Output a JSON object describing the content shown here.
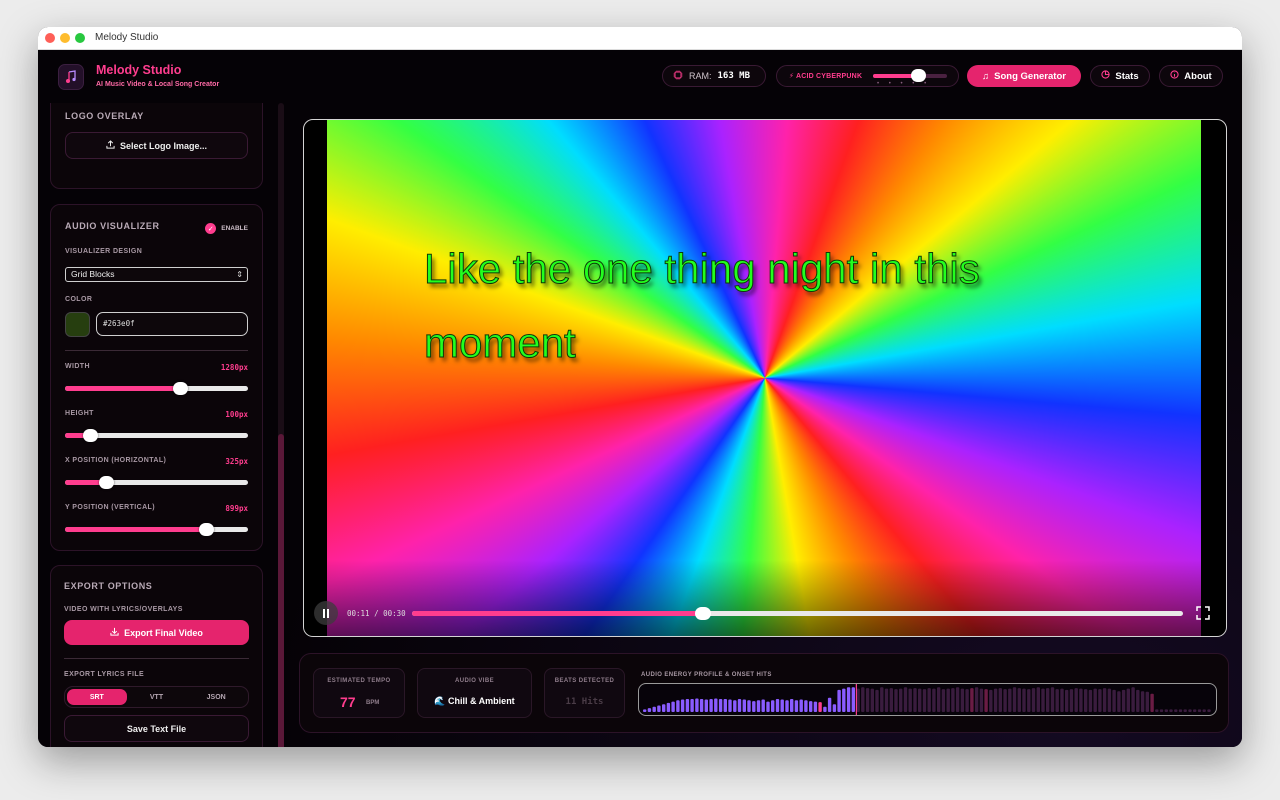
{
  "window": {
    "title": "Melody Studio"
  },
  "header": {
    "app_name": "Melody Studio",
    "tagline": "AI Music Video & Local Song Creator",
    "ram_label": "RAM:",
    "ram_value": "163 MB",
    "theme_label": "⚡ ACID CYBERPUNK",
    "theme_level": 0.65,
    "song_generator": "Song Generator",
    "stats": "Stats",
    "about": "About"
  },
  "sidebar": {
    "logo_overlay": {
      "title": "LOGO OVERLAY",
      "button": "Select Logo Image..."
    },
    "visualizer": {
      "title": "AUDIO VISUALIZER",
      "enable_label": "ENABLE",
      "enabled": true,
      "design_label": "VISUALIZER DESIGN",
      "design_value": "Grid Blocks",
      "color_label": "COLOR",
      "color_hex": "#263e0f",
      "width_label": "WIDTH",
      "width_value": "1280px",
      "width_level": 0.64,
      "height_label": "HEIGHT",
      "height_value": "100px",
      "height_level": 0.11,
      "x_label": "X POSITION (HORIZONTAL)",
      "x_value": "325px",
      "x_level": 0.2,
      "y_label": "Y POSITION (VERTICAL)",
      "y_value": "899px",
      "y_level": 0.8
    },
    "export": {
      "title": "EXPORT OPTIONS",
      "video_label": "VIDEO WITH LYRICS/OVERLAYS",
      "export_button": "Export Final Video",
      "lyrics_label": "EXPORT LYRICS FILE",
      "formats": [
        "SRT",
        "VTT",
        "JSON"
      ],
      "active_format": "SRT",
      "save_button": "Save Text File"
    }
  },
  "player": {
    "lyrics": "Like the one thing night in this moment",
    "time": "00:11 / 00:30",
    "progress": 0.375
  },
  "analysis": {
    "tempo_label": "ESTIMATED TEMPO",
    "tempo_value": "77",
    "tempo_unit": "BPM",
    "vibe_label": "AUDIO VIBE",
    "vibe_value": "🌊 Chill & Ambient",
    "beats_label": "BEATS DETECTED",
    "beats_value": "11 Hits",
    "energy_label": "AUDIO ENERGY PROFILE & ONSET HITS",
    "playhead": 0.375,
    "energy": [
      0.1,
      0.15,
      0.2,
      0.25,
      0.3,
      0.35,
      0.4,
      0.45,
      0.48,
      0.5,
      0.5,
      0.52,
      0.5,
      0.48,
      0.5,
      0.52,
      0.5,
      0.5,
      0.48,
      0.45,
      0.5,
      0.48,
      0.45,
      0.42,
      0.45,
      0.48,
      0.4,
      0.45,
      0.5,
      0.48,
      0.45,
      0.5,
      0.45,
      0.48,
      0.45,
      0.42,
      0.4,
      0.38,
      0.2,
      0.55,
      0.3,
      0.85,
      0.9,
      0.95,
      0.95,
      0.9,
      0.95,
      0.92,
      0.9,
      0.85,
      0.95,
      0.9,
      0.92,
      0.88,
      0.9,
      0.95,
      0.9,
      0.92,
      0.9,
      0.88,
      0.92,
      0.9,
      0.95,
      0.88,
      0.9,
      0.92,
      0.95,
      0.9,
      0.88,
      0.92,
      0.95,
      0.9,
      0.88,
      0.85,
      0.9,
      0.92,
      0.88,
      0.9,
      0.95,
      0.92,
      0.9,
      0.88,
      0.92,
      0.95,
      0.9,
      0.92,
      0.95,
      0.88,
      0.9,
      0.85,
      0.88,
      0.92,
      0.9,
      0.88,
      0.85,
      0.9,
      0.88,
      0.92,
      0.9,
      0.85,
      0.8,
      0.85,
      0.9,
      0.95,
      0.85,
      0.8,
      0.78,
      0.7,
      0.1,
      0.1,
      0.1,
      0.1,
      0.1,
      0.1,
      0.1,
      0.1,
      0.1,
      0.1,
      0.1,
      0.1
    ],
    "onsets": [
      37,
      69,
      72,
      107
    ]
  }
}
